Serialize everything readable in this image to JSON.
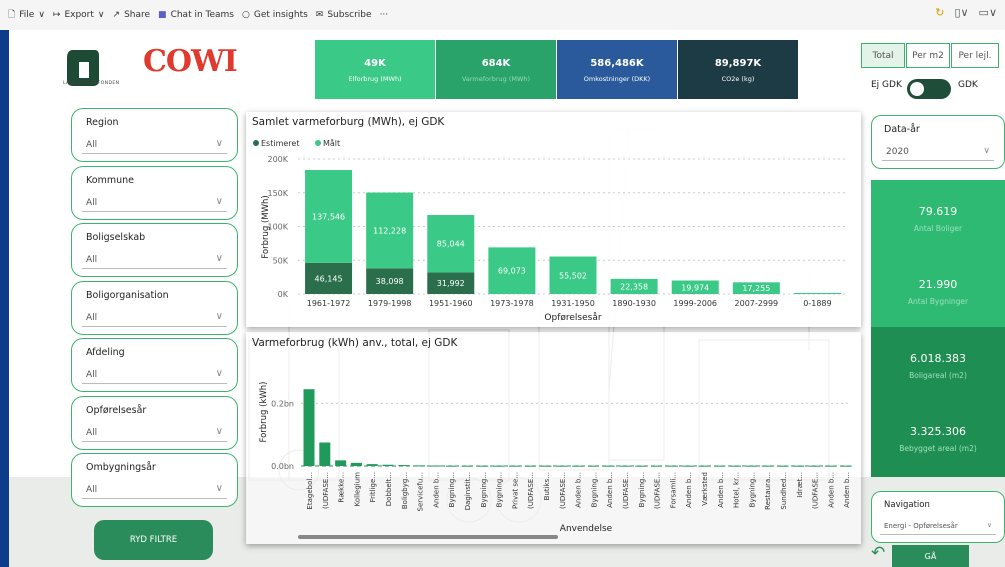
{
  "toolbar": {
    "file": "File",
    "export": "Export",
    "share": "Share",
    "teams": "Chat in Teams",
    "insights": "Get insights",
    "subscribe": "Subscribe",
    "more": "···"
  },
  "brand": {
    "logo_text": "LANDSBYGGEFONDEN",
    "cowi": "COWI"
  },
  "kpis": [
    {
      "value": "49K",
      "label": "Elforbrug (MWh)",
      "color": "#3ac986"
    },
    {
      "value": "684K",
      "label": "Varmeforbrug (MWh)",
      "color": "#2aa36a"
    },
    {
      "value": "586,486K",
      "label": "Omkostninger (DKK)",
      "color": "#2a5a9b"
    },
    {
      "value": "89,897K",
      "label": "CO2e (kg)",
      "color": "#1d3b44"
    }
  ],
  "toggles": {
    "total": "Total",
    "per_m2": "Per m2",
    "per_lejl": "Per lejl."
  },
  "gdk": {
    "left": "Ej GDK",
    "right": "GDK"
  },
  "filters": [
    {
      "title": "Region",
      "value": "All"
    },
    {
      "title": "Kommune",
      "value": "All"
    },
    {
      "title": "Boligselskab",
      "value": "All"
    },
    {
      "title": "Boligorganisation",
      "value": "All"
    },
    {
      "title": "Afdeling",
      "value": "All"
    },
    {
      "title": "Opførelsesår",
      "value": "All"
    },
    {
      "title": "Ombygningsår",
      "value": "All"
    }
  ],
  "ryd_label": "RYD FILTRE",
  "data_year": {
    "title": "Data-år",
    "value": "2020"
  },
  "stats": [
    {
      "value": "79.619",
      "label": "Antal Boliger"
    },
    {
      "value": "21.990",
      "label": "Antal Bygninger"
    },
    {
      "value": "6.018.383",
      "label": "Boligareal (m2)"
    },
    {
      "value": "3.325.306",
      "label": "Bebygget areal (m2)"
    }
  ],
  "navigation": {
    "title": "Navigation",
    "value": "Energi - Opførelsesår",
    "go": "GÅ"
  },
  "colors": {
    "accent": "#3cb46e",
    "estimeret": "#2a6e4c",
    "maalt": "#3ac986",
    "bar2": "#1f9a5a"
  },
  "chart_data": [
    {
      "type": "bar",
      "title": "Samlet varmeforburg (MWh), ej GDK",
      "xlabel": "Opførelsesår",
      "ylabel": "Forbrug (MWh)",
      "ylim": [
        0,
        200000
      ],
      "yticks": [
        "0K",
        "50K",
        "100K",
        "150K",
        "200K"
      ],
      "categories": [
        "1961-1972",
        "1979-1998",
        "1951-1960",
        "1973-1978",
        "1931-1950",
        "1890-1930",
        "1999-2006",
        "2007-2999",
        "0-1889"
      ],
      "series": [
        {
          "name": "Estimeret",
          "values": [
            46145,
            38098,
            31992,
            0,
            0,
            0,
            0,
            0,
            0
          ],
          "labels": [
            "46,145",
            "38,098",
            "31,992",
            "",
            "",
            "",
            "",
            "",
            ""
          ]
        },
        {
          "name": "Målt",
          "values": [
            137546,
            112228,
            85044,
            69073,
            55502,
            22358,
            19974,
            17255,
            1500
          ],
          "labels": [
            "137,546",
            "112,228",
            "85,044",
            "69,073",
            "55,502",
            "22,358",
            "19,974",
            "17,255",
            ""
          ]
        }
      ]
    },
    {
      "type": "bar",
      "title": "Varmeforbrug (kWh) anv., total, ej GDK",
      "xlabel": "Anvendelse",
      "ylabel": "Forbrug (kWh)",
      "ylim": [
        0,
        0.3
      ],
      "yticks": [
        "0.0bn",
        "0.2bn"
      ],
      "categories": [
        "Etagebol...",
        "(UDFASE...",
        "Række...",
        "Kollegium",
        "Fritlige...",
        "Dobbelt...",
        "Boligbyg...",
        "Servicefu...",
        "Anden b...",
        "Bygning...",
        "Daginstit...",
        "Bygning...",
        "Bygning...",
        "Privat se...",
        "(UDFASE...",
        "Butiks...",
        "(UDFASE...",
        "Anden b...",
        "Bygning...",
        "Anden b...",
        "(UDFASE...",
        "Bygning...",
        "(UDFASE...",
        "Forsamli...",
        "Anden b...",
        "Værksted",
        "Anden b...",
        "Hotel, kr...",
        "Bygning...",
        "Restaura...",
        "Sundhed...",
        "Idræt...",
        "(UDFASE...",
        "Anden b...",
        "Anden b..."
      ],
      "values": [
        0.245,
        0.075,
        0.018,
        0.01,
        0.006,
        0.004,
        0.003,
        0.002,
        0.0015,
        0.001,
        0.001,
        0.001,
        0.001,
        0.001,
        0.001,
        0.001,
        0.001,
        0.001,
        0.001,
        0.001,
        0.001,
        0.001,
        0.001,
        0.001,
        0.001,
        0.001,
        0.001,
        0.001,
        0.001,
        0.001,
        0.001,
        0.001,
        0.001,
        0.001,
        0.001
      ]
    }
  ]
}
